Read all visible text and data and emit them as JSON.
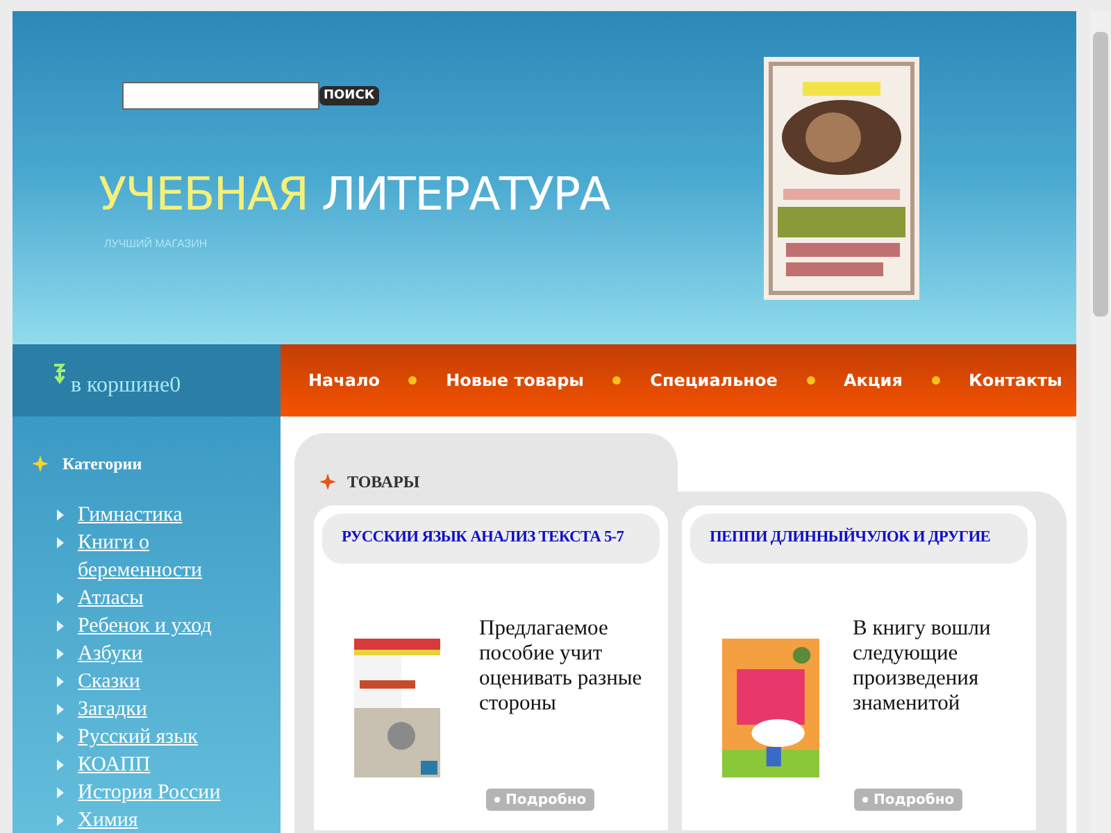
{
  "header": {
    "search": {
      "button": "ПОИСК"
    },
    "logo_main": "УЧЕБНАЯ",
    "logo_rest": "ЛИТЕРАТУРА",
    "tagline": "ЛУЧШИЙ МАГАЗИН"
  },
  "cart": {
    "label": "в коршине0"
  },
  "nav": [
    "Начало",
    "Новые товары",
    "Специальное",
    "Акция",
    "Контакты"
  ],
  "sidebar": {
    "title": "Категории",
    "items": [
      "Гимнастика",
      "Книги о беременности",
      "Атласы",
      "Ребенок и уход",
      "Азбуки",
      "Сказки",
      "Загадки",
      "Русский язык",
      "КОАПП",
      "История России",
      "Химия"
    ]
  },
  "products": {
    "title": "ТОВАРЫ",
    "items": [
      {
        "name": "РУССКИИ ЯЗЫК АНАЛИЗ ТЕКСТА 5-7",
        "description": "Предлагаемое пособие учит оценивать разные стороны",
        "button": "Подробно"
      },
      {
        "name": "ПЕППИ ДЛИННЫЙЧУЛОК И ДРУГИЕ",
        "description": "В книгу вошли следующие произведения знаменитой",
        "button": "Подробно"
      }
    ]
  }
}
